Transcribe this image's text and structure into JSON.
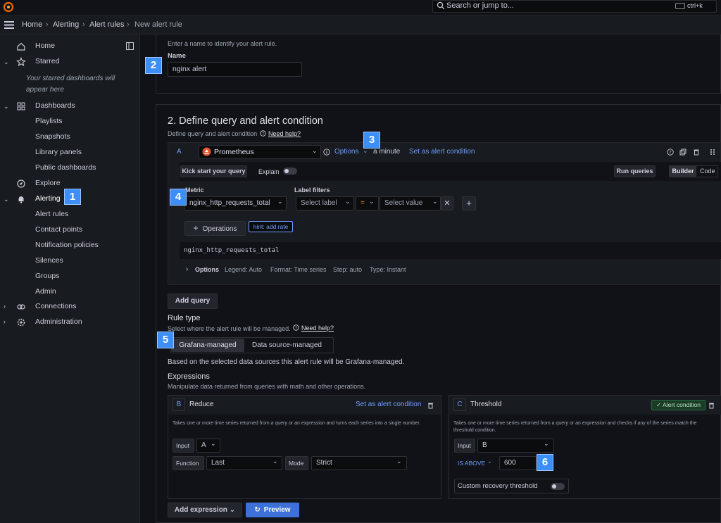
{
  "app": {
    "search_placeholder": "Search or jump to...",
    "shortcut": "ctrl+k"
  },
  "breadcrumb": [
    "Home",
    "Alerting",
    "Alert rules",
    "New alert rule"
  ],
  "sidebar": {
    "home": "Home",
    "starred": "Starred",
    "starred_empty": "Your starred dashboards will appear here",
    "dashboards": "Dashboards",
    "playlists": "Playlists",
    "snapshots": "Snapshots",
    "library_panels": "Library panels",
    "public_dashboards": "Public dashboards",
    "explore": "Explore",
    "alerting": "Alerting",
    "alert_rules": "Alert rules",
    "contact_points": "Contact points",
    "notification_policies": "Notification policies",
    "silences": "Silences",
    "groups": "Groups",
    "admin": "Admin",
    "connections": "Connections",
    "administration": "Administration"
  },
  "badges": [
    "1",
    "2",
    "3",
    "4",
    "5",
    "6"
  ],
  "name_section": {
    "hint": "Enter a name to identify your alert rule.",
    "label": "Name",
    "value": "nginx alert"
  },
  "query_section": {
    "title": "2. Define query and alert condition",
    "subtitle": "Define query and alert condition",
    "help": "Need help?",
    "query_letter": "A",
    "datasource": "Prometheus",
    "options": "Options",
    "interval": "a minute",
    "set_condition": "Set as alert condition",
    "kick_start": "Kick start your query",
    "explain": "Explain",
    "run_queries": "Run queries",
    "builder": "Builder",
    "code": "Code",
    "metric_label": "Metric",
    "metric_value": "nginx_http_requests_total",
    "label_filters": "Label filters",
    "select_label": "Select label",
    "operator": "=",
    "select_value": "Select value",
    "operations": "Operations",
    "hint": "hint: add rate",
    "raw_query": "nginx_http_requests_total",
    "options_label": "Options",
    "legend": "Legend: Auto",
    "format": "Format: Time series",
    "step": "Step: auto",
    "type": "Type: Instant",
    "add_query": "Add query"
  },
  "rule_type": {
    "title": "Rule type",
    "subtitle": "Select where the alert rule will be managed.",
    "help": "Need help?",
    "grafana_managed": "Grafana-managed",
    "datasource_managed": "Data source-managed",
    "note": "Based on the selected data sources this alert rule will be Grafana-managed."
  },
  "expressions": {
    "title": "Expressions",
    "subtitle": "Manipulate data returned from queries with math and other operations.",
    "reduce": {
      "letter": "B",
      "name": "Reduce",
      "set_condition": "Set as alert condition",
      "description": "Takes one or more time series returned from a query or an expression and turns each series into a single number.",
      "input_label": "Input",
      "input_value": "A",
      "function_label": "Function",
      "function_value": "Last",
      "mode_label": "Mode",
      "mode_value": "Strict"
    },
    "threshold": {
      "letter": "C",
      "name": "Threshold",
      "condition_badge": "✓ Alert condition",
      "description": "Takes one or more time series returned from a query or an expression and checks if any of the series match the threshold condition.",
      "input_label": "Input",
      "input_value": "B",
      "operator": "IS ABOVE",
      "value": "600",
      "recovery": "Custom recovery threshold"
    },
    "add_expression": "Add expression",
    "preview": "Preview"
  }
}
